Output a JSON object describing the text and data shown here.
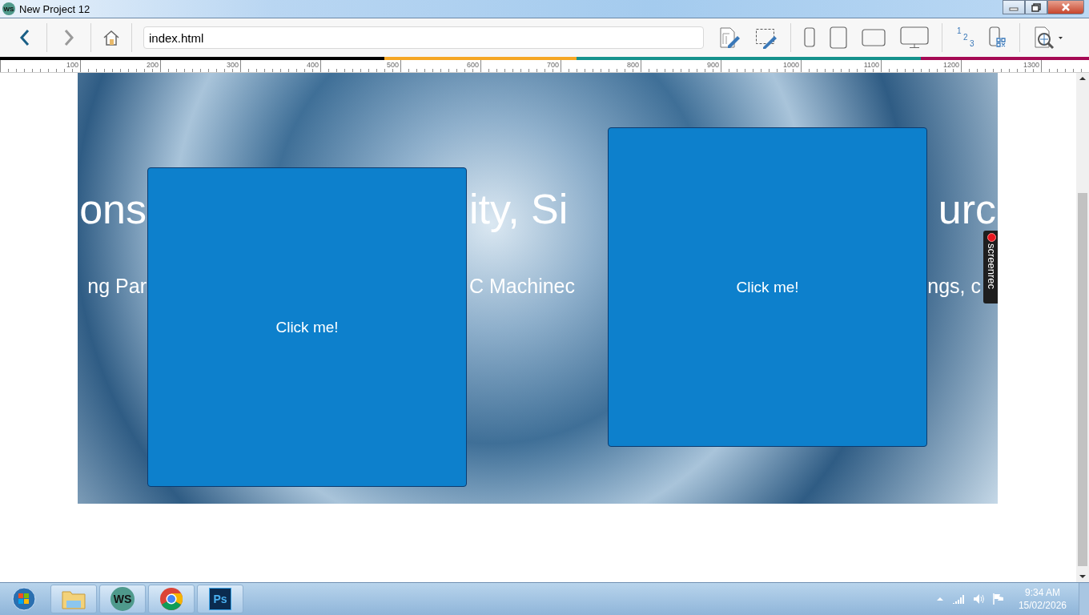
{
  "window": {
    "logo": "WS",
    "title": "New Project 12"
  },
  "toolbar": {
    "nav": [
      {
        "kind": "back",
        "disabled": false
      },
      {
        "kind": "forward",
        "disabled": true
      }
    ],
    "address": "index.html",
    "sequence_digits": [
      "1",
      "2",
      "3"
    ]
  },
  "ruler": {
    "breakpoints": [
      {
        "color": "#000000"
      },
      {
        "color": "#f5a623"
      },
      {
        "color": "#15918c"
      },
      {
        "color": "#a50a54"
      }
    ],
    "labels": [
      "100",
      "200",
      "300",
      "400",
      "500",
      "600",
      "700",
      "800",
      "900",
      "1000",
      "1100",
      "1200",
      "1300"
    ]
  },
  "page": {
    "heading_fragments": [
      "ons",
      "ity, Si",
      "urc"
    ],
    "subheading_fragments": [
      "ng Par",
      "C Machinec",
      "ngs, c"
    ],
    "buttons": [
      {
        "label": "Click me!"
      },
      {
        "label": "Click me!"
      }
    ]
  },
  "overlay": {
    "label": "screenrec"
  },
  "taskbar": {
    "apps": [
      {
        "kind": "folder"
      },
      {
        "kind": "ws",
        "label": "WS"
      },
      {
        "kind": "chrome"
      },
      {
        "kind": "photoshop",
        "label": "Ps"
      }
    ],
    "time": "9:34 AM",
    "date": "15/02/2026"
  }
}
